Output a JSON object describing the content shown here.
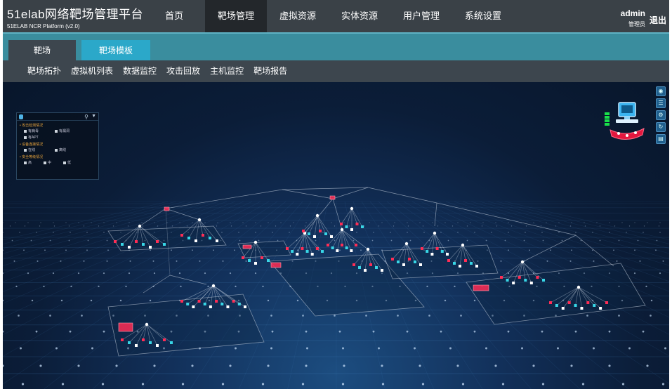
{
  "header": {
    "title": "51elab网络靶场管理平台",
    "subtitle": "51ELAB NCR Platform (v2.0)",
    "nav": [
      {
        "label": "首页",
        "active": false
      },
      {
        "label": "靶场管理",
        "active": true
      },
      {
        "label": "虚拟资源",
        "active": false
      },
      {
        "label": "实体资源",
        "active": false
      },
      {
        "label": "用户管理",
        "active": false
      },
      {
        "label": "系统设置",
        "active": false
      }
    ],
    "user": {
      "name": "admin",
      "role": "管理员"
    },
    "logout": "退出"
  },
  "tabs": [
    {
      "label": "靶场",
      "active": true
    },
    {
      "label": "靶场模板",
      "active": false
    }
  ],
  "subnav": [
    "靶场拓扑",
    "虚拟机列表",
    "数据监控",
    "攻击回放",
    "主机监控",
    "靶场报告"
  ],
  "legend": {
    "sections": [
      {
        "title": "• 攻击检测情况",
        "items": [
          [
            "有病毒",
            "有漏洞"
          ],
          [
            "有APT"
          ]
        ]
      },
      {
        "title": "• 设备连接情况",
        "items": [
          [
            "在线",
            "离线"
          ]
        ]
      },
      {
        "title": "• 安全等级情况",
        "items": [
          [
            "高",
            "中",
            "低"
          ]
        ]
      }
    ]
  },
  "toolbar": {
    "icons": [
      "zoom-icon",
      "layers-icon",
      "settings-icon",
      "refresh-icon",
      "document-icon"
    ]
  },
  "colors": {
    "topbar": "#3a4147",
    "nav_active": "#23272b",
    "tabstrip": "#3a8d9e",
    "tab_inactive": "#2ba8c9",
    "subnav": "#3d464e",
    "node_red": "#ff2d55",
    "node_cyan": "#38d6e6",
    "node_white": "#ffffff",
    "link": "#cfd9e6"
  }
}
